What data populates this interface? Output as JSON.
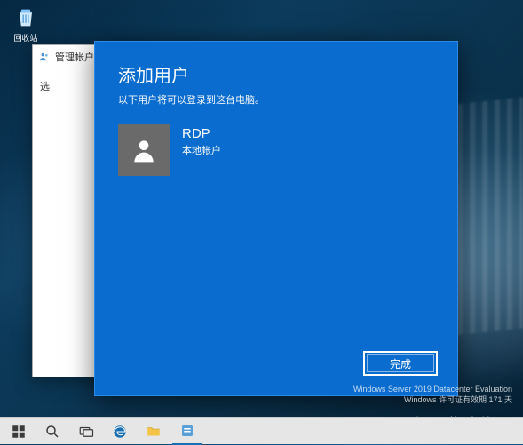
{
  "desktop": {
    "recycle_bin_label": "回收站"
  },
  "back_window": {
    "title": "管理帐户",
    "prompt": "选"
  },
  "dialog": {
    "title": "添加用户",
    "subtitle": "以下用户将可以登录到这台电脑。",
    "user": {
      "name": "RDP",
      "type": "本地帐户"
    },
    "finish_label": "完成"
  },
  "build_info": {
    "line1": "Windows Server 2019 Datacenter Evaluation",
    "line2": "Windows 许可证有效期 171 天"
  },
  "watermark": "小火猫手游网",
  "taskbar": {
    "start": "start-icon",
    "search": "search-icon",
    "taskview": "taskview-icon",
    "edge": "edge-icon",
    "explorer": "file-explorer-icon",
    "app": "active-app-icon"
  }
}
